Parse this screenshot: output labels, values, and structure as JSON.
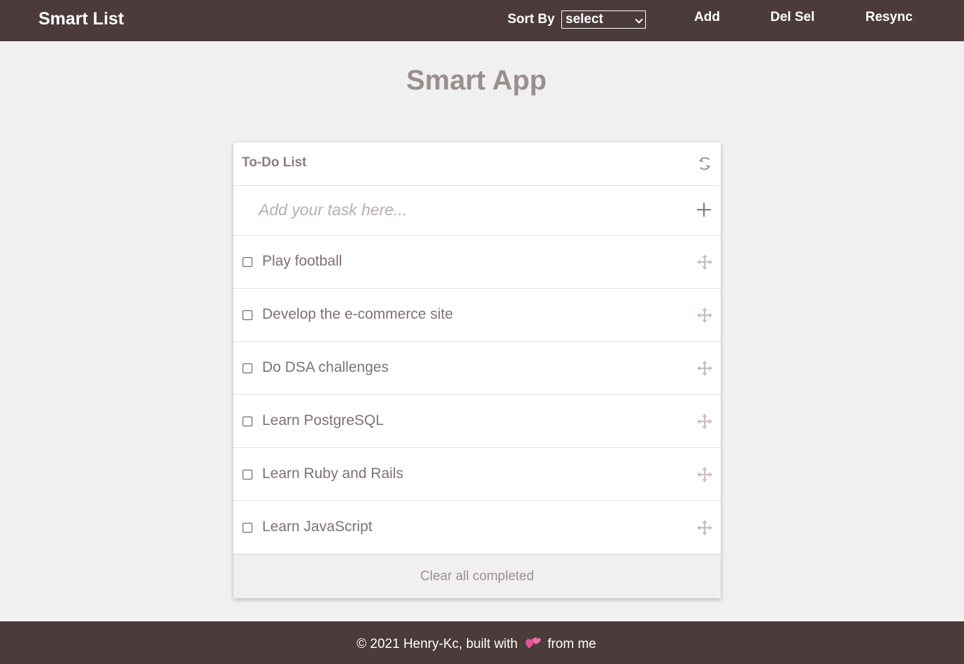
{
  "navbar": {
    "brand": "Smart List",
    "sort_label": "Sort By",
    "sort_selected": "select",
    "links": {
      "add": "Add",
      "del_sel": "Del Sel",
      "resync": "Resync"
    }
  },
  "page": {
    "title": "Smart App"
  },
  "todo": {
    "title": "To-Do List",
    "input_placeholder": "Add your task here...",
    "tasks": [
      {
        "text": "Play football",
        "checked": false
      },
      {
        "text": "Develop the e-commerce site",
        "checked": false
      },
      {
        "text": "Do DSA challenges",
        "checked": false
      },
      {
        "text": "Learn PostgreSQL",
        "checked": false
      },
      {
        "text": "Learn Ruby and Rails",
        "checked": false
      },
      {
        "text": "Learn JavaScript",
        "checked": false
      }
    ],
    "clear_label": "Clear all completed"
  },
  "footer": {
    "prefix": "© 2021 Henry-Kc, built with",
    "suffix": "from me"
  },
  "icons": {
    "refresh": "refresh-icon",
    "add": "plus-icon",
    "drag": "move-icon",
    "heart": "heart-icon"
  },
  "colors": {
    "nav_bg": "#4c3b3b",
    "page_bg": "#f0f0f0",
    "muted_text": "#9a8f8d",
    "task_text": "#7e7270"
  }
}
